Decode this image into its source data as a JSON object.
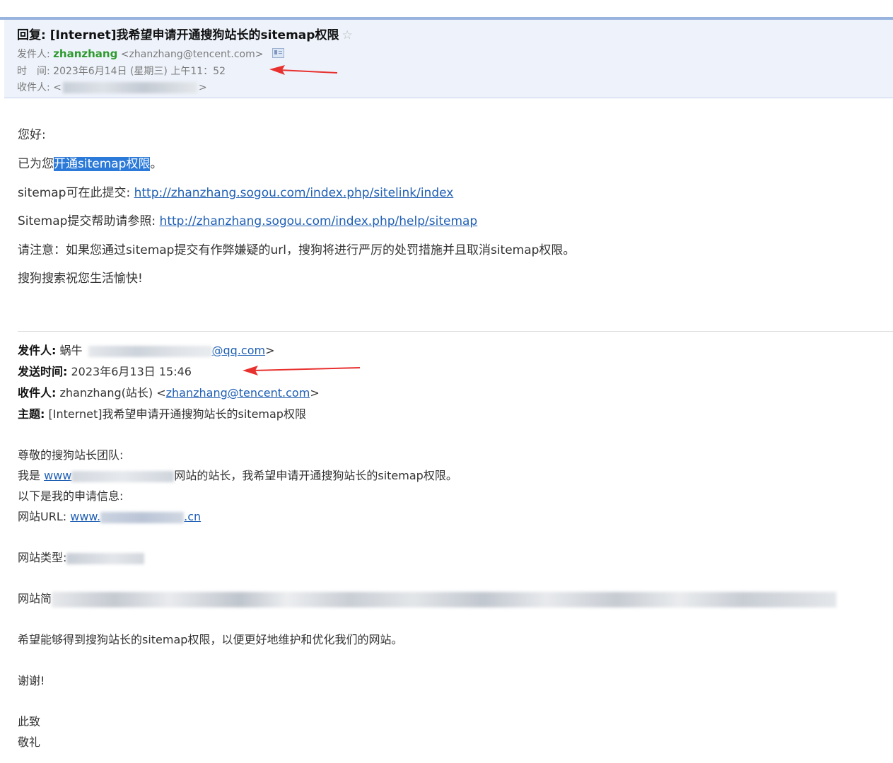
{
  "header": {
    "subject": "回复: [Internet]我希望申请开通搜狗站长的sitemap权限",
    "star_icon": "star-outline-icon",
    "from_label": "发件人:",
    "from_name": "zhanzhang",
    "from_email": "<zhanzhang@tencent.com>",
    "time_label": "时　间:",
    "time_value": "2023年6月14日 (星期三) 上午11：52",
    "to_label": "收件人:",
    "to_open": "<",
    "to_close": ">"
  },
  "reply": {
    "greeting": "您好:",
    "opened_prefix": "已为您",
    "opened_highlight": "开通sitemap权限",
    "opened_suffix": "。",
    "submit_prefix": "sitemap可在此提交:",
    "submit_link": "http://zhanzhang.sogou.com/index.php/sitelink/index",
    "help_prefix": "Sitemap提交帮助请参照:",
    "help_link": "http://zhanzhang.sogou.com/index.php/help/sitemap",
    "note": "请注意：如果您通过sitemap提交有作弊嫌疑的url，搜狗将进行严厉的处罚措施并且取消sitemap权限。",
    "wish": "搜狗搜索祝您生活愉快!"
  },
  "quoted": {
    "from_label": "发件人:",
    "from_name": "蜗牛",
    "from_email_tail": "@qq.com",
    "from_close": ">",
    "time_label": "发送时间:",
    "time_value": "2023年6月13日 15:46",
    "to_label": "收件人:",
    "to_name": "zhanzhang(站长) <",
    "to_email": "zhanzhang@tencent.com",
    "to_close": ">",
    "subject_label": "主题:",
    "subject_value": "[Internet]我希望申请开通搜狗站长的sitemap权限",
    "dear": "尊敬的搜狗站长团队:",
    "iam_prefix": "我是",
    "iam_site_start": "www",
    "iam_suffix": "网站的站长，我希望申请开通搜狗站长的sitemap权限。",
    "below": "以下是我的申请信息:",
    "url_label": "网站URL:",
    "url_start": "www.",
    "url_end": ".cn",
    "type_label": "网站类型:",
    "intro_label": "网站简",
    "hope": "希望能够得到搜狗站长的sitemap权限，以便更好地维护和优化我们的网站。",
    "thanks": "谢谢!",
    "closing1": "此致",
    "closing2": "敬礼"
  },
  "annotations": {
    "arrow_color": "#e8312f"
  }
}
